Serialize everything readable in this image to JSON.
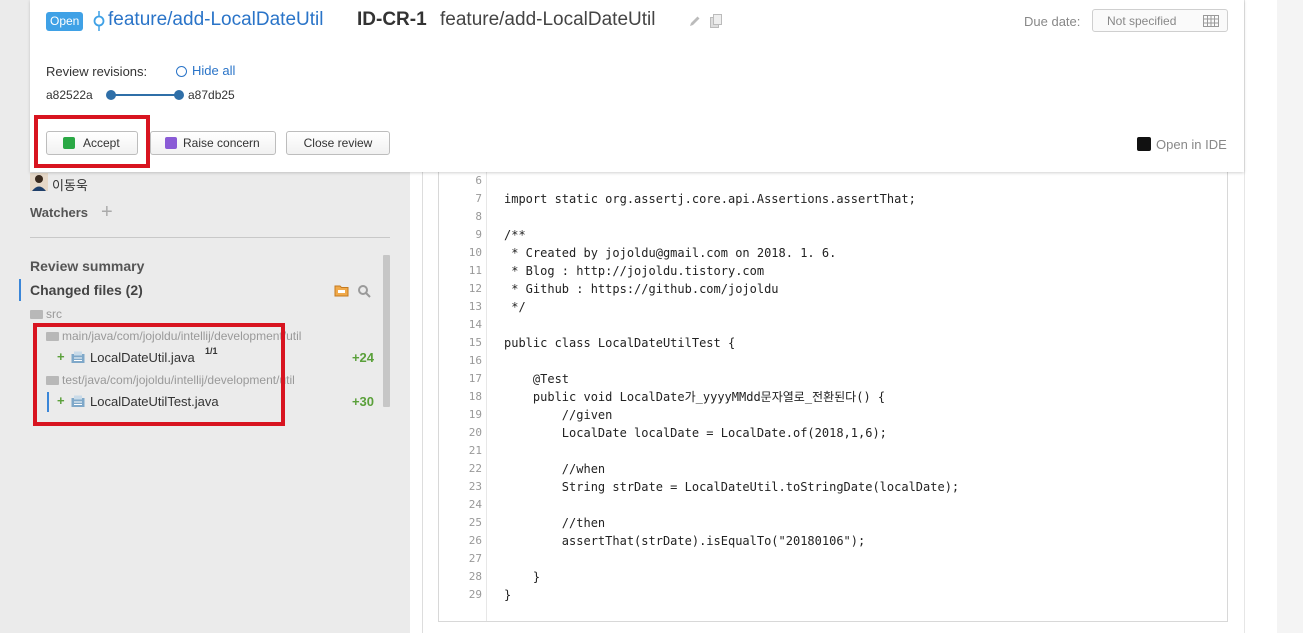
{
  "header": {
    "status": "Open",
    "branch": "feature/add-LocalDateUtil",
    "review_id": "ID-CR-1",
    "review_title": "feature/add-LocalDateUtil",
    "due_label": "Due date:",
    "due_value": "Not specified"
  },
  "revisions": {
    "label": "Review revisions:",
    "hide_all": "Hide all",
    "from": "a82522a",
    "to": "a87db25"
  },
  "actions": {
    "accept": "Accept",
    "raise_concern": "Raise concern",
    "close_review": "Close review",
    "open_in_ide": "Open in IDE"
  },
  "sidebar": {
    "author": "이동욱",
    "watchers": "Watchers",
    "review_summary": "Review summary",
    "changed_files": "Changed files (2)",
    "tree": {
      "root": "src",
      "folders": [
        {
          "path": "main/java/com/jojoldu/intellij/development/util",
          "files": [
            {
              "name": "LocalDateUtil.java",
              "revision": "1/1",
              "delta": "+24"
            }
          ]
        },
        {
          "path": "test/java/com/jojoldu/intellij/development/util",
          "files": [
            {
              "name": "LocalDateUtilTest.java",
              "revision": "",
              "delta": "+30"
            }
          ]
        }
      ]
    }
  },
  "code": {
    "lines": [
      {
        "n": "6",
        "t": ""
      },
      {
        "n": "7",
        "t": "import static org.assertj.core.api.Assertions.assertThat;"
      },
      {
        "n": "8",
        "t": ""
      },
      {
        "n": "9",
        "t": "/**"
      },
      {
        "n": "10",
        "t": " * Created by jojoldu@gmail.com on 2018. 1. 6."
      },
      {
        "n": "11",
        "t": " * Blog : http://jojoldu.tistory.com"
      },
      {
        "n": "12",
        "t": " * Github : https://github.com/jojoldu"
      },
      {
        "n": "13",
        "t": " */"
      },
      {
        "n": "14",
        "t": ""
      },
      {
        "n": "15",
        "t": "public class LocalDateUtilTest {"
      },
      {
        "n": "16",
        "t": ""
      },
      {
        "n": "17",
        "t": "    @Test"
      },
      {
        "n": "18",
        "t": "    public void LocalDate가_yyyyMMdd문자열로_전환된다() {"
      },
      {
        "n": "19",
        "t": "        //given"
      },
      {
        "n": "20",
        "t": "        LocalDate localDate = LocalDate.of(2018,1,6);"
      },
      {
        "n": "21",
        "t": ""
      },
      {
        "n": "22",
        "t": "        //when"
      },
      {
        "n": "23",
        "t": "        String strDate = LocalDateUtil.toStringDate(localDate);"
      },
      {
        "n": "24",
        "t": ""
      },
      {
        "n": "25",
        "t": "        //then"
      },
      {
        "n": "26",
        "t": "        assertThat(strDate).isEqualTo(\"20180106\");"
      },
      {
        "n": "27",
        "t": ""
      },
      {
        "n": "28",
        "t": "    }"
      },
      {
        "n": "29",
        "t": "}"
      }
    ]
  },
  "colors": {
    "accent": "#2a74c8",
    "status_pill": "#3fa1e6",
    "added": "#5aa03a",
    "highlight": "#d81420"
  }
}
